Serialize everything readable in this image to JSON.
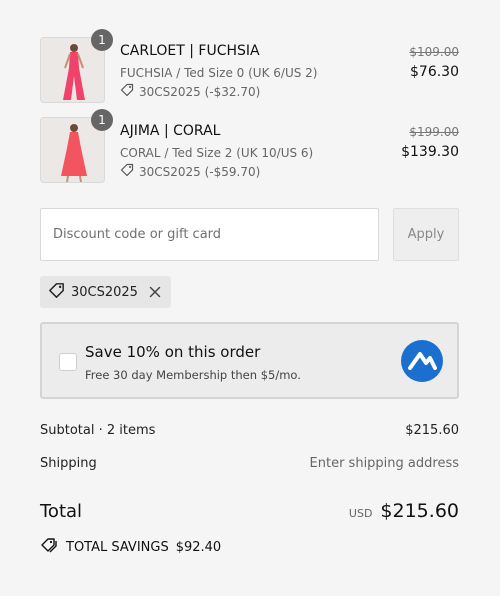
{
  "items": [
    {
      "quantity": "1",
      "name": "CARLOET | FUCHSIA",
      "variant": "FUCHSIA / Ted Size 0 (UK 6/US 2)",
      "discount": "30CS2025 (-$32.70)",
      "original_price": "$109.00",
      "price": "$76.30",
      "garment_color": "#f0426a"
    },
    {
      "quantity": "1",
      "name": "AJIMA | CORAL",
      "variant": "CORAL / Ted Size 2 (UK 10/US 6)",
      "discount": "30CS2025 (-$59.70)",
      "original_price": "$199.00",
      "price": "$139.30",
      "garment_color": "#f2555f"
    }
  ],
  "discount": {
    "placeholder": "Discount code or gift card",
    "value": "",
    "apply_label": "Apply",
    "applied_code": "30CS2025"
  },
  "membership": {
    "title": "Save 10% on this order",
    "subtitle": "Free 30 day Membership then $5/mo.",
    "logo_color": "#1a6fcf"
  },
  "summary": {
    "subtotal_label": "Subtotal · 2 items",
    "subtotal_value": "$215.60",
    "shipping_label": "Shipping",
    "shipping_value": "Enter shipping address",
    "total_label": "Total",
    "currency": "USD",
    "total_value": "$215.60",
    "savings_label": "TOTAL SAVINGS",
    "savings_value": "$92.40"
  }
}
